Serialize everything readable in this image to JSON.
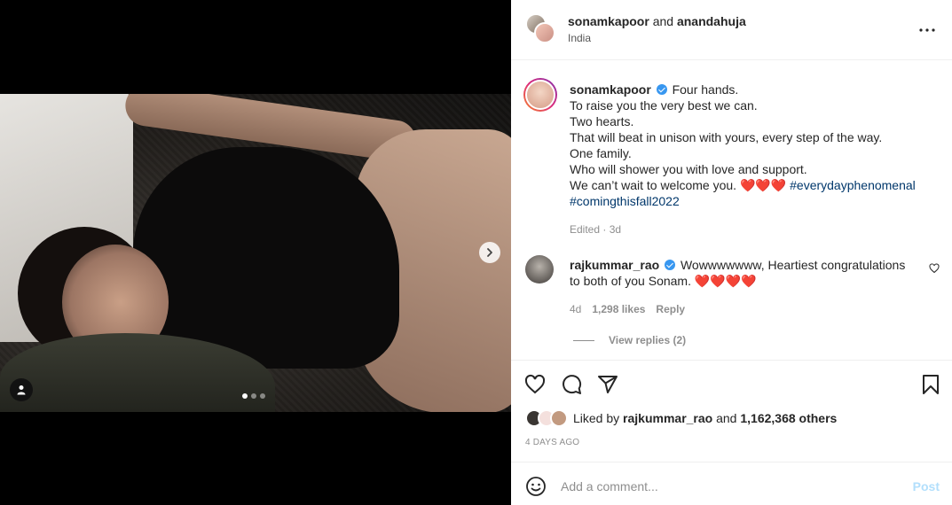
{
  "header": {
    "user1": "sonamkapoor",
    "conjunction": "and",
    "user2": "anandahuja",
    "location": "India"
  },
  "caption": {
    "username": "sonamkapoor",
    "lines": [
      "Four hands.",
      "To raise you the very best we can.",
      "Two hearts.",
      "That will beat in unison with yours, every step of the way.",
      "One family.",
      "Who will shower you with love and support."
    ],
    "last_line": "We can’t wait to welcome you.",
    "hearts": "❤️❤️❤️",
    "hashtag1": "#everydayphenomenal",
    "hashtag2": "#comingthisfall2022",
    "edited": "Edited · 3d"
  },
  "comment": {
    "username": "rajkummar_rao",
    "text": "Wowwwwwww, Heartiest congratulations to both of you Sonam.",
    "hearts": "❤️❤️❤️❤️",
    "age": "4d",
    "likes": "1,298 likes",
    "reply": "Reply",
    "view_replies": "View replies (2)"
  },
  "likes": {
    "prefix": "Liked by",
    "user": "rajkummar_rao",
    "and": "and",
    "others": "1,162,368 others"
  },
  "time_ago": "4 DAYS AGO",
  "add_comment": {
    "placeholder": "Add a comment...",
    "post": "Post"
  },
  "carousel": {
    "current": 1,
    "total": 3
  },
  "icons": {
    "more": "more-options-icon",
    "like": "heart-icon",
    "comment": "comment-icon",
    "share": "share-icon",
    "save": "bookmark-icon",
    "emoji": "emoji-icon",
    "tag": "user-tag-icon",
    "next": "chevron-right-icon"
  },
  "colors": {
    "accent_link": "#00376b",
    "post_disabled": "#b2dffc",
    "verified": "#3897f0"
  }
}
